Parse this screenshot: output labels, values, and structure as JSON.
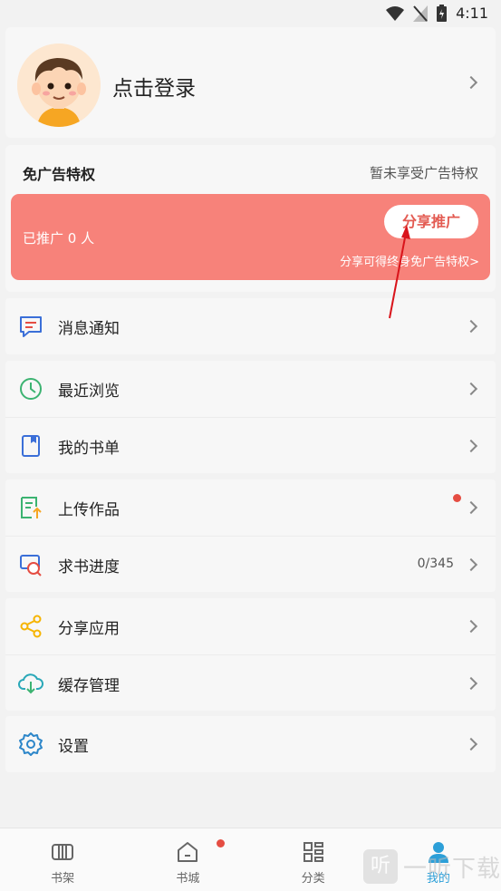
{
  "status_bar": {
    "time": "4:11"
  },
  "profile": {
    "login_text": "点击登录"
  },
  "ad_privilege": {
    "title": "免广告特权",
    "status": "暂未享受广告特权",
    "promoted_text": "已推广 0 人",
    "share_button": "分享推广",
    "share_hint": "分享可得终身免广告特权>"
  },
  "menu": {
    "notifications": "消息通知",
    "recent": "最近浏览",
    "booklist": "我的书单",
    "upload": "上传作品",
    "request": "求书进度",
    "request_count": "0/345",
    "share_app": "分享应用",
    "cache": "缓存管理",
    "settings": "设置"
  },
  "nav": {
    "bookshelf": "书架",
    "bookstore": "书城",
    "category": "分类",
    "mine": "我的"
  },
  "watermark": {
    "icon_char": "听",
    "text": "一听下载"
  },
  "colors": {
    "accent": "#2c9fd8",
    "banner": "#f7827a",
    "badge": "#e54d42"
  }
}
